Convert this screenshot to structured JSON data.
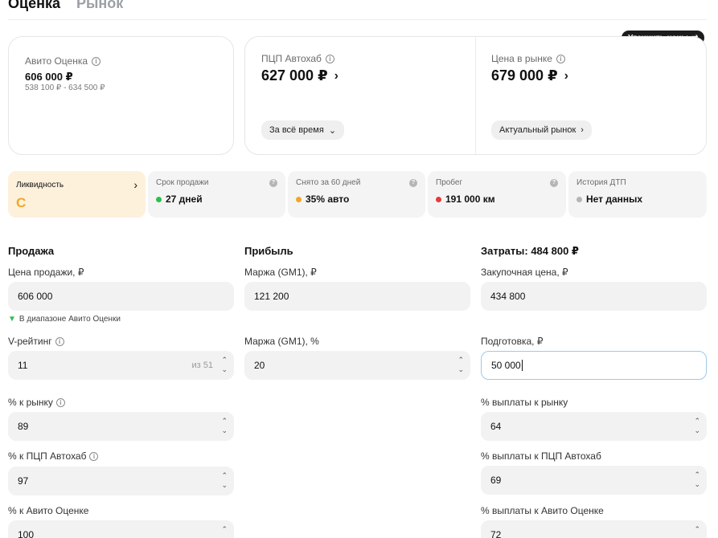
{
  "tabs": [
    {
      "label": "Оценка",
      "active": true
    },
    {
      "label": "Рынок",
      "active": false
    }
  ],
  "refine_button": {
    "label": "Уточнить цены",
    "icon": "sliders-icon"
  },
  "avito_estimate": {
    "label": "Авито Оценка",
    "value": "606 000 ₽",
    "range": "538 100 ₽ - 634 500 ₽"
  },
  "pcp": {
    "label": "ПЦП Автохаб",
    "value": "627 000 ₽",
    "button": "За всё время"
  },
  "market_price": {
    "label": "Цена в рынке",
    "value": "679 000 ₽",
    "button": "Актуальный рынок"
  },
  "metrics": [
    {
      "label": "Ликвидность",
      "value": "C",
      "highlight": true
    },
    {
      "label": "Срок продажи",
      "value": "27 дней",
      "dot_color": "#2cbf4f"
    },
    {
      "label": "Снято за 60 дней",
      "value": "35% авто",
      "dot_color": "#f3a623"
    },
    {
      "label": "Пробег",
      "value": "191 000 км",
      "dot_color": "#e8393a"
    },
    {
      "label": "История ДТП",
      "value": "Нет данных",
      "dot_color": "#b5b5b5"
    }
  ],
  "sale": {
    "title": "Продажа",
    "price_label": "Цена продажи, ₽",
    "price_value": "606 000",
    "note": "В диапазоне Авито Оценки",
    "vrating_label": "V-рейтинг",
    "vrating_value": "11",
    "vrating_suffix": "из 51",
    "pct_market_label": "% к рынку",
    "pct_market_value": "89",
    "pct_pcp_label": "% к ПЦП Автохаб",
    "pct_pcp_value": "97",
    "pct_avito_label": "% к Авито Оценке",
    "pct_avito_value": "100"
  },
  "profit": {
    "title": "Прибыль",
    "margin_rub_label": "Маржа (GM1), ₽",
    "margin_rub_value": "121 200",
    "margin_pct_label": "Маржа (GM1), %",
    "margin_pct_value": "20"
  },
  "costs": {
    "title": "Затраты: 484 800 ₽",
    "purchase_label": "Закупочная цена, ₽",
    "purchase_value": "434 800",
    "prep_label": "Подготовка, ₽",
    "prep_value": "50 000",
    "payout_market_label": "% выплаты к рынку",
    "payout_market_value": "64",
    "payout_pcp_label": "% выплаты к ПЦП Автохаб",
    "payout_pcp_value": "69",
    "payout_avito_label": "% выплаты к Авито Оценке",
    "payout_avito_value": "72"
  }
}
